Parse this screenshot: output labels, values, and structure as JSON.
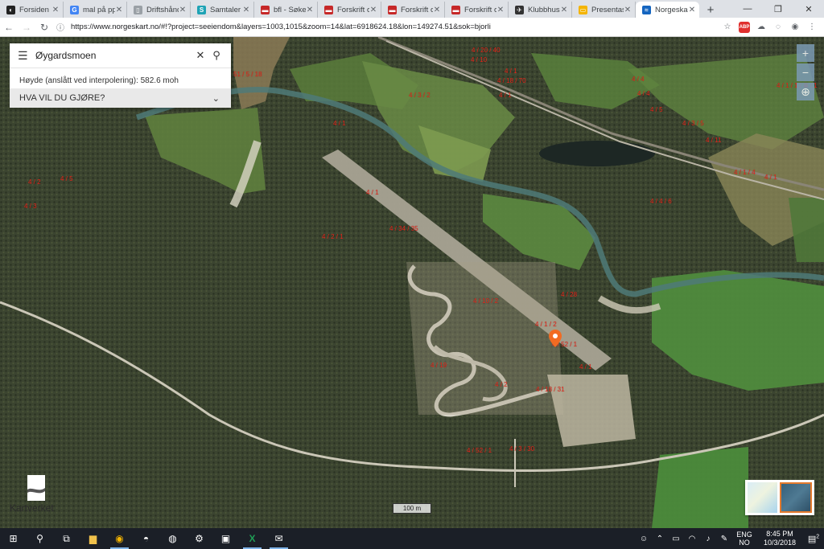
{
  "browser": {
    "tabs": [
      {
        "title": "Forsiden -",
        "fav_color": "#222222",
        "fav_glyph": "◐",
        "active": false
      },
      {
        "title": "mal på ppt",
        "fav_color": "#4285f4",
        "fav_glyph": "G",
        "active": false
      },
      {
        "title": "Driftshånd",
        "fav_color": "#9aa0a6",
        "fav_glyph": "▯",
        "active": false
      },
      {
        "title": "Samtaler",
        "fav_color": "#1fa3b5",
        "fav_glyph": "S",
        "active": false
      },
      {
        "title": "bfl - Søker",
        "fav_color": "#c62828",
        "fav_glyph": "▬",
        "active": false
      },
      {
        "title": "Forskrift o",
        "fav_color": "#c62828",
        "fav_glyph": "▬",
        "active": false
      },
      {
        "title": "Forskrift o",
        "fav_color": "#c62828",
        "fav_glyph": "▬",
        "active": false
      },
      {
        "title": "Forskrift o",
        "fav_color": "#c62828",
        "fav_glyph": "▬",
        "active": false
      },
      {
        "title": "Klubbhuse",
        "fav_color": "#333333",
        "fav_glyph": "✈",
        "active": false
      },
      {
        "title": "Presentasj",
        "fav_color": "#f4b400",
        "fav_glyph": "▭",
        "active": false
      },
      {
        "title": "Norgeskart",
        "fav_color": "#1565c0",
        "fav_glyph": "≈",
        "active": true
      }
    ],
    "new_tab": "+",
    "window_controls": [
      "—",
      "❐",
      "✕"
    ],
    "url": "https://www.norgeskart.no/#!?project=seeiendom&layers=1003,1015&zoom=14&lat=6918624.18&lon=149274.51&sok=bjorli"
  },
  "map": {
    "search_value": "Øygardsmoen",
    "height_text": "Høyde (anslått ved interpolering): 582.6 moh",
    "action_label": "HVA VIL DU GJØRE?",
    "zoom_in": "+",
    "zoom_out": "−",
    "locate": "⊕",
    "logo_text": "Kartverket",
    "scale_text": "100 m",
    "parcel_labels": [
      "51 / 5 / 18",
      "4 / 20 / 40",
      "4 / 10",
      "4 / 1",
      "4 / 18 / 70",
      "4 / 3 / 2",
      "4 / 1",
      "4 / 1",
      "4 / 2",
      "4 / 5",
      "4 / 3",
      "4 / 1 / 1 / 6",
      "4 / 4",
      "4 / 4",
      "4 / 5",
      "4 / 3 / 5",
      "4 / 11",
      "4 / 1 / 4",
      "4 / 4 / 6",
      "4 / 1",
      "4 / 34 / 35",
      "4 / 2 / 1",
      "4 / 28",
      "4 / 10 / 2",
      "4 / 1 / 2",
      "4 / 52 / 1",
      "4 / 19",
      "4 / 1",
      "4 / 2",
      "4 / 18 / 31",
      "4 / 52 / 1",
      "4 / 3 / 30",
      "4 / 1",
      "4 / 1"
    ]
  },
  "taskbar": {
    "apps": [
      {
        "name": "start",
        "glyph": "⊞",
        "open": false
      },
      {
        "name": "search",
        "glyph": "⚲",
        "open": false
      },
      {
        "name": "task-view",
        "glyph": "⧉",
        "open": false
      },
      {
        "name": "file-explorer",
        "glyph": "▆",
        "open": false
      },
      {
        "name": "chrome",
        "glyph": "◉",
        "open": true
      },
      {
        "name": "edge",
        "glyph": "◓",
        "open": false
      },
      {
        "name": "vpn",
        "glyph": "◍",
        "open": false
      },
      {
        "name": "settings",
        "glyph": "⚙",
        "open": false
      },
      {
        "name": "remote-desktop",
        "glyph": "▣",
        "open": false
      },
      {
        "name": "excel",
        "glyph": "X",
        "open": true
      },
      {
        "name": "mail",
        "glyph": "✉",
        "open": true
      }
    ],
    "lang_top": "ENG",
    "lang_bottom": "NO",
    "time": "8:45 PM",
    "date": "10/3/2018",
    "notif_count": "2"
  }
}
